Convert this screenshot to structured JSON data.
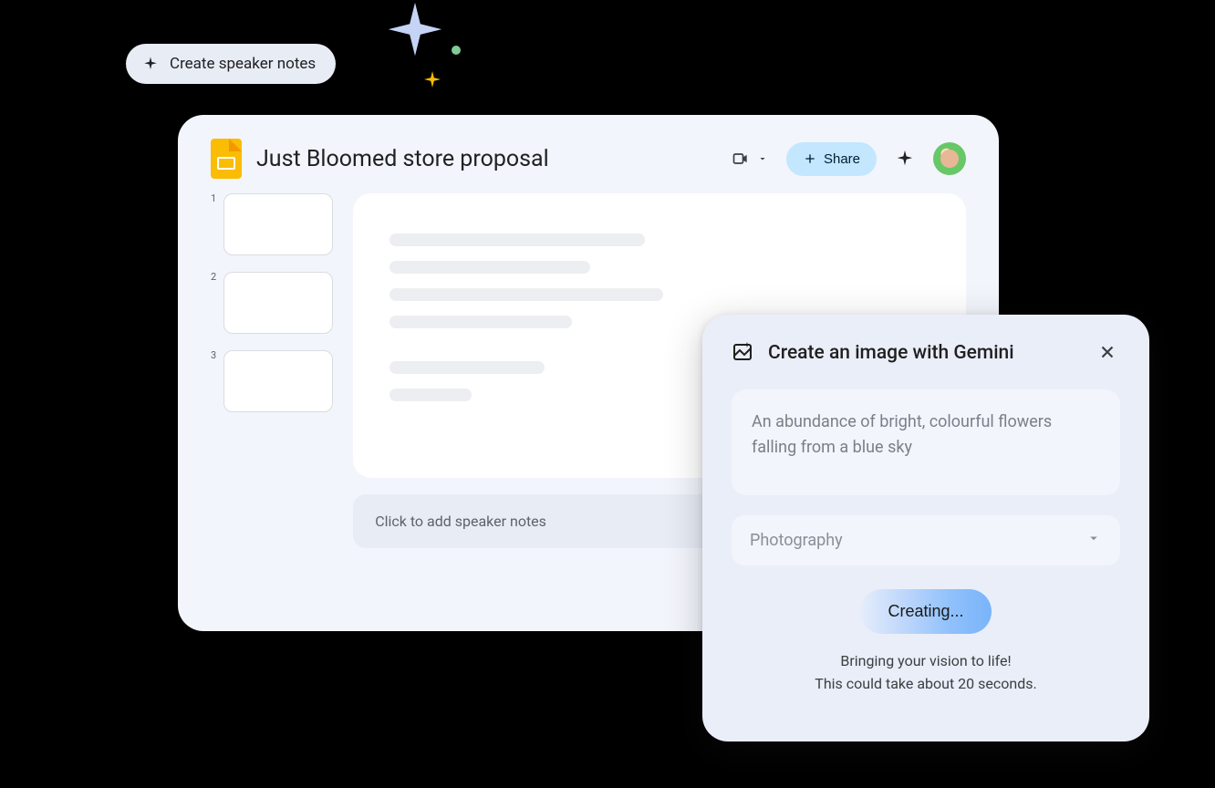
{
  "chip": {
    "label": "Create speaker notes"
  },
  "slides": {
    "title": "Just Bloomed store proposal",
    "share_label": "Share",
    "thumbs": [
      "1",
      "2",
      "3"
    ],
    "speaker_notes_placeholder": "Click to add speaker notes"
  },
  "gemini": {
    "title": "Create an image with Gemini",
    "prompt": "An abundance of bright, colourful flowers falling from a blue sky",
    "style_selected": "Photography",
    "creating_label": "Creating...",
    "status_line1": "Bringing your vision to life!",
    "status_line2": "This could take about 20 seconds."
  }
}
